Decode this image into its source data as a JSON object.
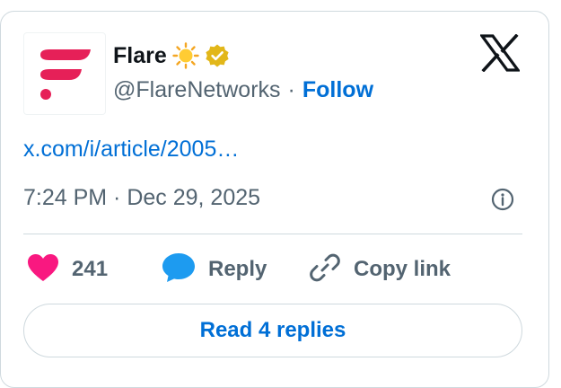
{
  "tweet": {
    "author_name": "Flare",
    "author_handle": "@FlareNetworks",
    "separator": "·",
    "follow_label": "Follow",
    "link_text": "x.com/i/article/2005…",
    "timestamp": "7:24 PM · Dec 29, 2025",
    "like_count": "241",
    "reply_label": "Reply",
    "copy_link_label": "Copy link",
    "read_replies_label": "Read 4 replies"
  },
  "icons": {
    "avatar": "flare-logo",
    "sun": "sun-emoji-icon",
    "verified": "gold-verified-badge-icon",
    "platform": "x-logo-icon",
    "info": "info-icon",
    "like": "heart-icon",
    "reply": "speech-bubble-icon",
    "copy": "link-icon"
  },
  "colors": {
    "brand_pink": "#e62058",
    "link_blue": "#006fd6",
    "like_pink": "#f91880",
    "reply_blue": "#1d9bf0",
    "verified_gold": "#e2b719",
    "muted_text": "#536471",
    "primary_text": "#0f1419",
    "border": "#cfd9de"
  }
}
